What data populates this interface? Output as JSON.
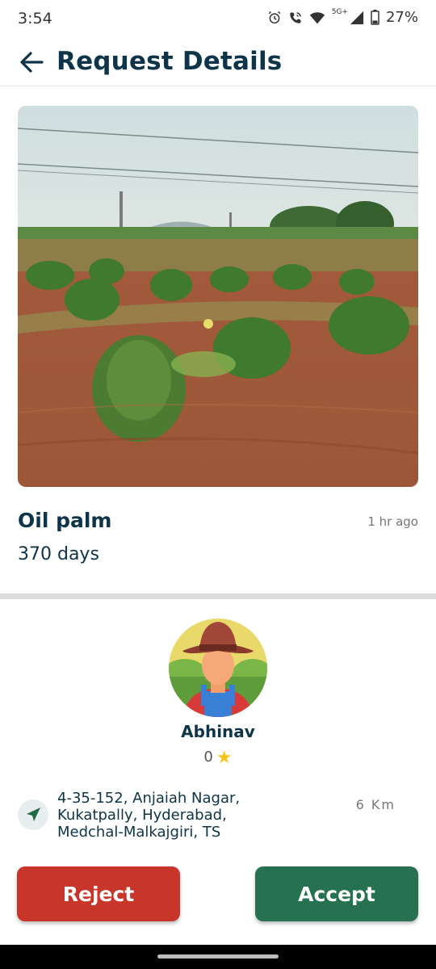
{
  "status_bar": {
    "time": "3:54",
    "network": "5G+",
    "battery": "27%",
    "icons": [
      "alarm-icon",
      "wifi-calling-icon",
      "wifi-icon",
      "signal-icon",
      "battery-icon"
    ]
  },
  "header": {
    "title": "Request Details",
    "back_icon": "arrow-left-icon"
  },
  "request": {
    "image": "oil-palm-field-photo",
    "crop": "Oil palm",
    "duration": "370 days",
    "posted": "1 hr ago"
  },
  "user": {
    "name": "Abhinav",
    "rating": "0",
    "rating_icon": "star-icon",
    "avatar": "farmer-avatar",
    "address": "4-35-152, Anjaiah Nagar,\nKukatpally, Hyderabad,\nMedchal-Malkajgiri, TS",
    "distance": "6 Km",
    "location_icon": "navigation-arrow-icon"
  },
  "actions": {
    "reject_label": "Reject",
    "accept_label": "Accept",
    "reject_color": "#c8352b",
    "accept_color": "#257150"
  },
  "colors": {
    "text_primary": "#0d3448",
    "text_secondary": "#777777"
  }
}
